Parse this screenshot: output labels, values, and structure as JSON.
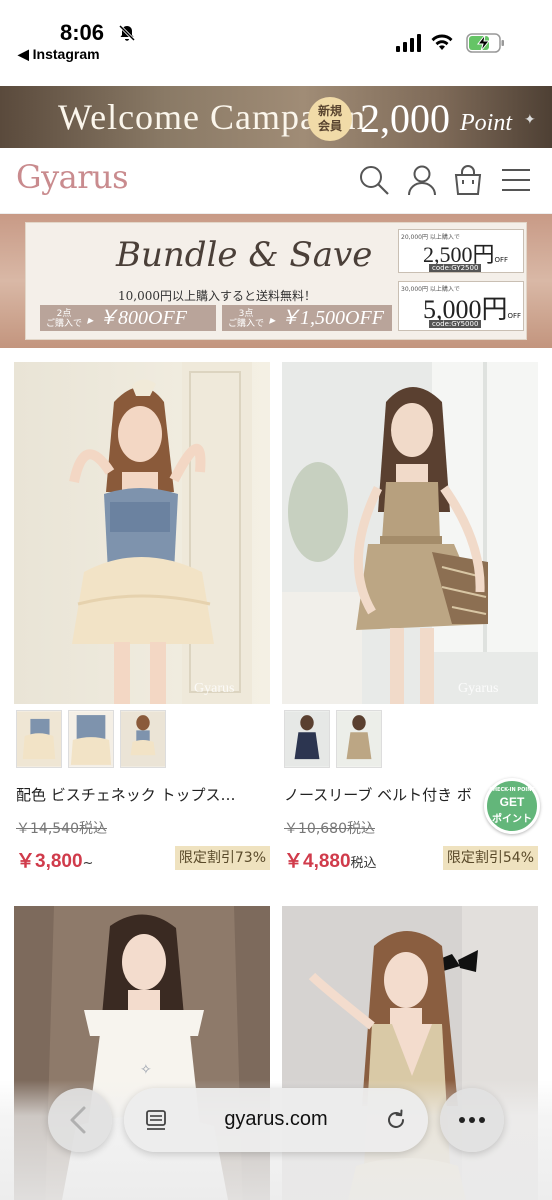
{
  "status_bar": {
    "time": "8:06",
    "back_app": "◀ Instagram"
  },
  "campaign": {
    "title": "Welcome Campaign",
    "badge_line1": "新規",
    "badge_line2": "会員",
    "amount": "2,000",
    "unit": "Point"
  },
  "header": {
    "logo": "Gyarus"
  },
  "banner": {
    "title": "Bundle & Save",
    "subtitle": "10,000円以上購入すると送料無料！",
    "offer1_qty": "2点",
    "offer1_note": "ご購入で",
    "offer1_amount": "￥800OFF",
    "offer2_qty": "3点",
    "offer2_note": "ご購入で",
    "offer2_amount": "￥1,500OFF",
    "coupon1_threshold": "20,000円 以上購入で",
    "coupon1_amount": "2,500円",
    "coupon1_off": "OFF",
    "coupon1_code": "code:GY2500",
    "coupon2_threshold": "30,000円 以上購入で",
    "coupon2_amount": "5,000円",
    "coupon2_off": "OFF",
    "coupon2_code": "code:GY5000"
  },
  "products": [
    {
      "name": "配色 ビスチェネック トップス…",
      "original_price": "￥14,540税込",
      "price": "￥3,800",
      "price_suffix": "~",
      "discount": "限定割引73%",
      "watermark": "Gyarus"
    },
    {
      "name": "ノースリーブ ベルト付き ボ",
      "original_price": "￥10,680税込",
      "price": "￥4,880",
      "price_suffix": "税込",
      "discount": "限定割引54%",
      "watermark": "Gyarus"
    }
  ],
  "get_badge": {
    "top": "CHECK-IN POINT",
    "line1": "GET",
    "line2": "ポイント"
  },
  "browser": {
    "url": "gyarus.com"
  },
  "colors": {
    "brand": "#c98b8e",
    "price": "#d03b4b",
    "discount_bg": "#efe2bf",
    "campaign_bg": "#8a7a66"
  }
}
